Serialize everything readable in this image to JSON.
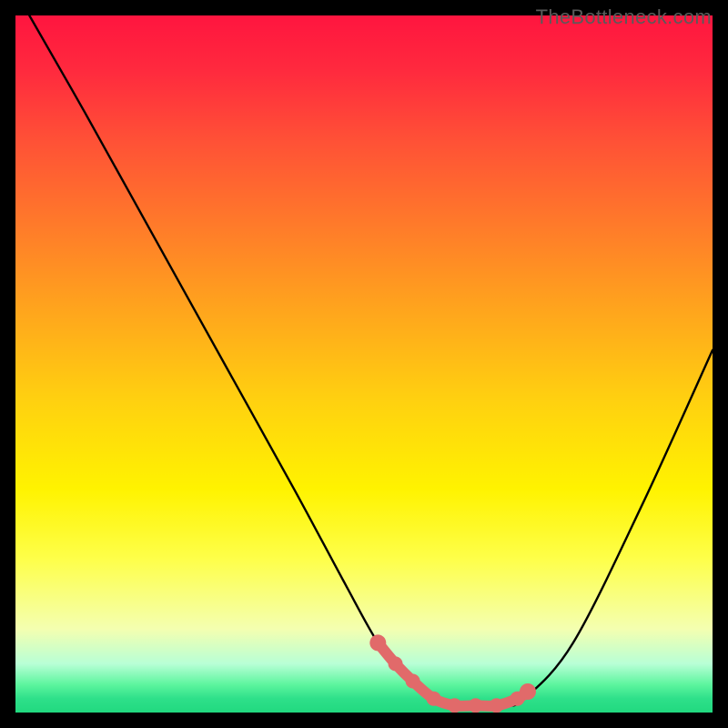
{
  "watermark": "TheBottleneck.com",
  "chart_data": {
    "type": "line",
    "title": "",
    "xlabel": "",
    "ylabel": "",
    "xlim": [
      0,
      100
    ],
    "ylim": [
      0,
      100
    ],
    "series": [
      {
        "name": "bottleneck-curve",
        "x": [
          2,
          10,
          20,
          30,
          40,
          47,
          52,
          56,
          61,
          65,
          70,
          73,
          80,
          90,
          100
        ],
        "values": [
          100,
          86,
          68,
          50,
          32,
          19,
          10,
          5,
          2,
          1,
          1,
          2,
          10,
          30,
          52
        ]
      }
    ],
    "markers": {
      "name": "highlight-markers",
      "x": [
        52,
        54.5,
        57,
        60,
        63,
        66,
        69,
        72,
        73.5
      ],
      "values": [
        10,
        7,
        4.5,
        2,
        1,
        1,
        1,
        2,
        3
      ]
    },
    "gradient_stops": [
      {
        "pct": 0,
        "color": "#ff153f"
      },
      {
        "pct": 18,
        "color": "#ff5136"
      },
      {
        "pct": 42,
        "color": "#ffa41d"
      },
      {
        "pct": 68,
        "color": "#fff300"
      },
      {
        "pct": 88,
        "color": "#f4ffb0"
      },
      {
        "pct": 96,
        "color": "#5cf59e"
      },
      {
        "pct": 100,
        "color": "#21d97f"
      }
    ]
  }
}
